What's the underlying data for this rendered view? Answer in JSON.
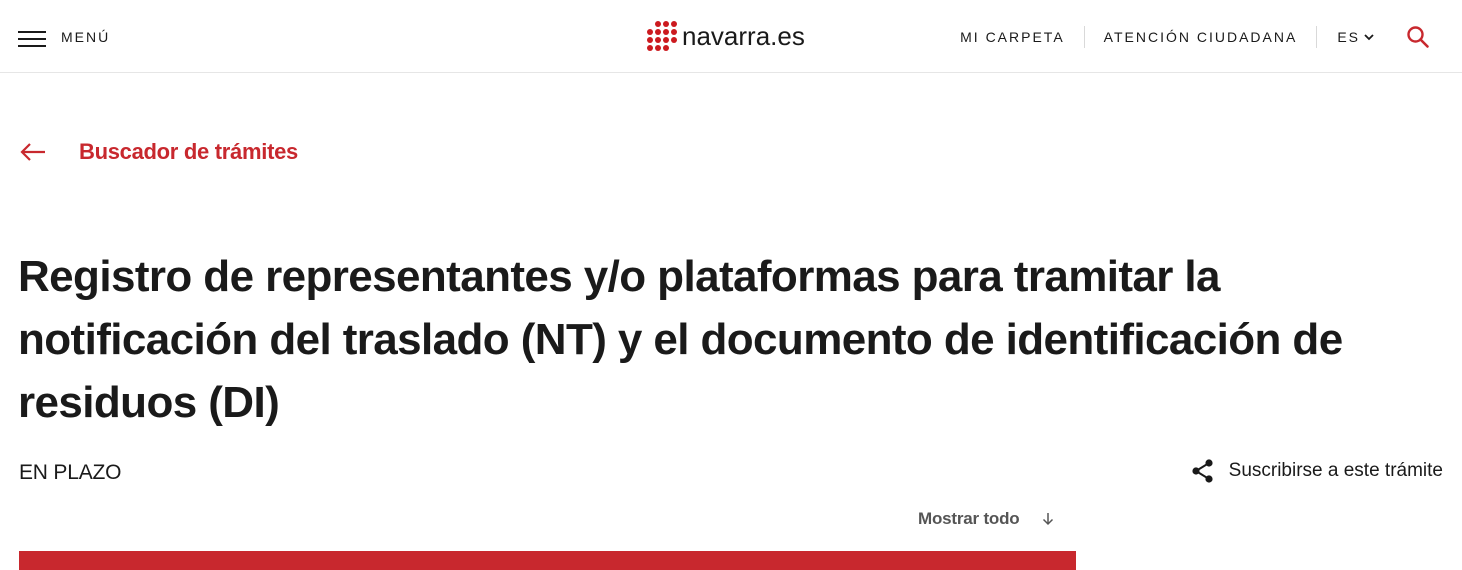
{
  "header": {
    "menu_label": "MENÚ",
    "logo_text": "navarra.es",
    "nav": {
      "mi_carpeta": "MI CARPETA",
      "atencion": "ATENCIÓN CIUDADANA",
      "language": "ES"
    },
    "icons": {
      "menu": "hamburger-icon",
      "search": "search-icon",
      "language": "chevron-down-icon"
    }
  },
  "breadcrumb": {
    "back_label": "Buscador de trámites",
    "icon": "arrow-left-icon"
  },
  "page": {
    "title": "Registro de representantes y/o plataformas para tramitar la notificación del traslado (NT) y el documento de identificación de residuos (DI)",
    "status": "EN PLAZO",
    "subscribe_label": "Suscribirse a este trámite",
    "subscribe_icon": "share-icon",
    "show_all_label": "Mostrar todo",
    "show_all_icon": "arrow-down-icon"
  },
  "colors": {
    "accent": "#c8282e",
    "logo_red": "#cc1a1f",
    "text": "#1a1a1a"
  }
}
